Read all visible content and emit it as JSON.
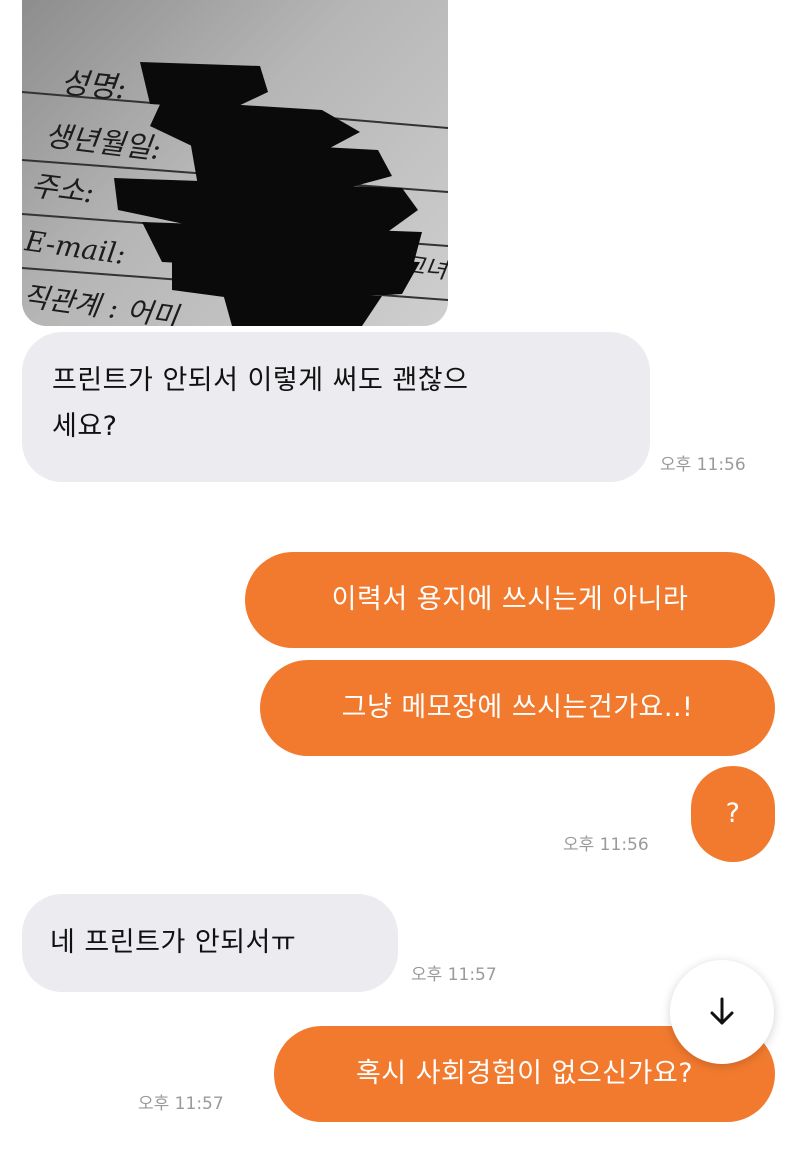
{
  "photo": {
    "lines": [
      "성명:",
      "생년월일:",
      "주소:",
      "E-mail:",
      "직관계 : 어미"
    ],
    "stray_text": "그녀"
  },
  "messages": [
    {
      "text": "프린트가 안되서 이렇게 써도 괜찮으세요?",
      "line1": "프린트가 안되서 이렇게 써도 괜찮으",
      "line2": "세요?",
      "time": "오후 11:56"
    },
    {
      "text": "이력서 용지에 쓰시는게 아니라"
    },
    {
      "text": "그냥 메모장에 쓰시는건가요..!"
    },
    {
      "text": "?",
      "time": "오후 11:56"
    },
    {
      "text": "네 프린트가 안되서ㅠ",
      "time": "오후 11:57"
    },
    {
      "text": "혹시 사회경험이 없으신가요?",
      "time": "오후 11:57"
    }
  ],
  "colors": {
    "outgoing": "#f27a2e",
    "incoming": "#ececf0",
    "timestamp": "#9a9a9a"
  },
  "icons": {
    "scroll_down": "arrow-down-icon"
  }
}
